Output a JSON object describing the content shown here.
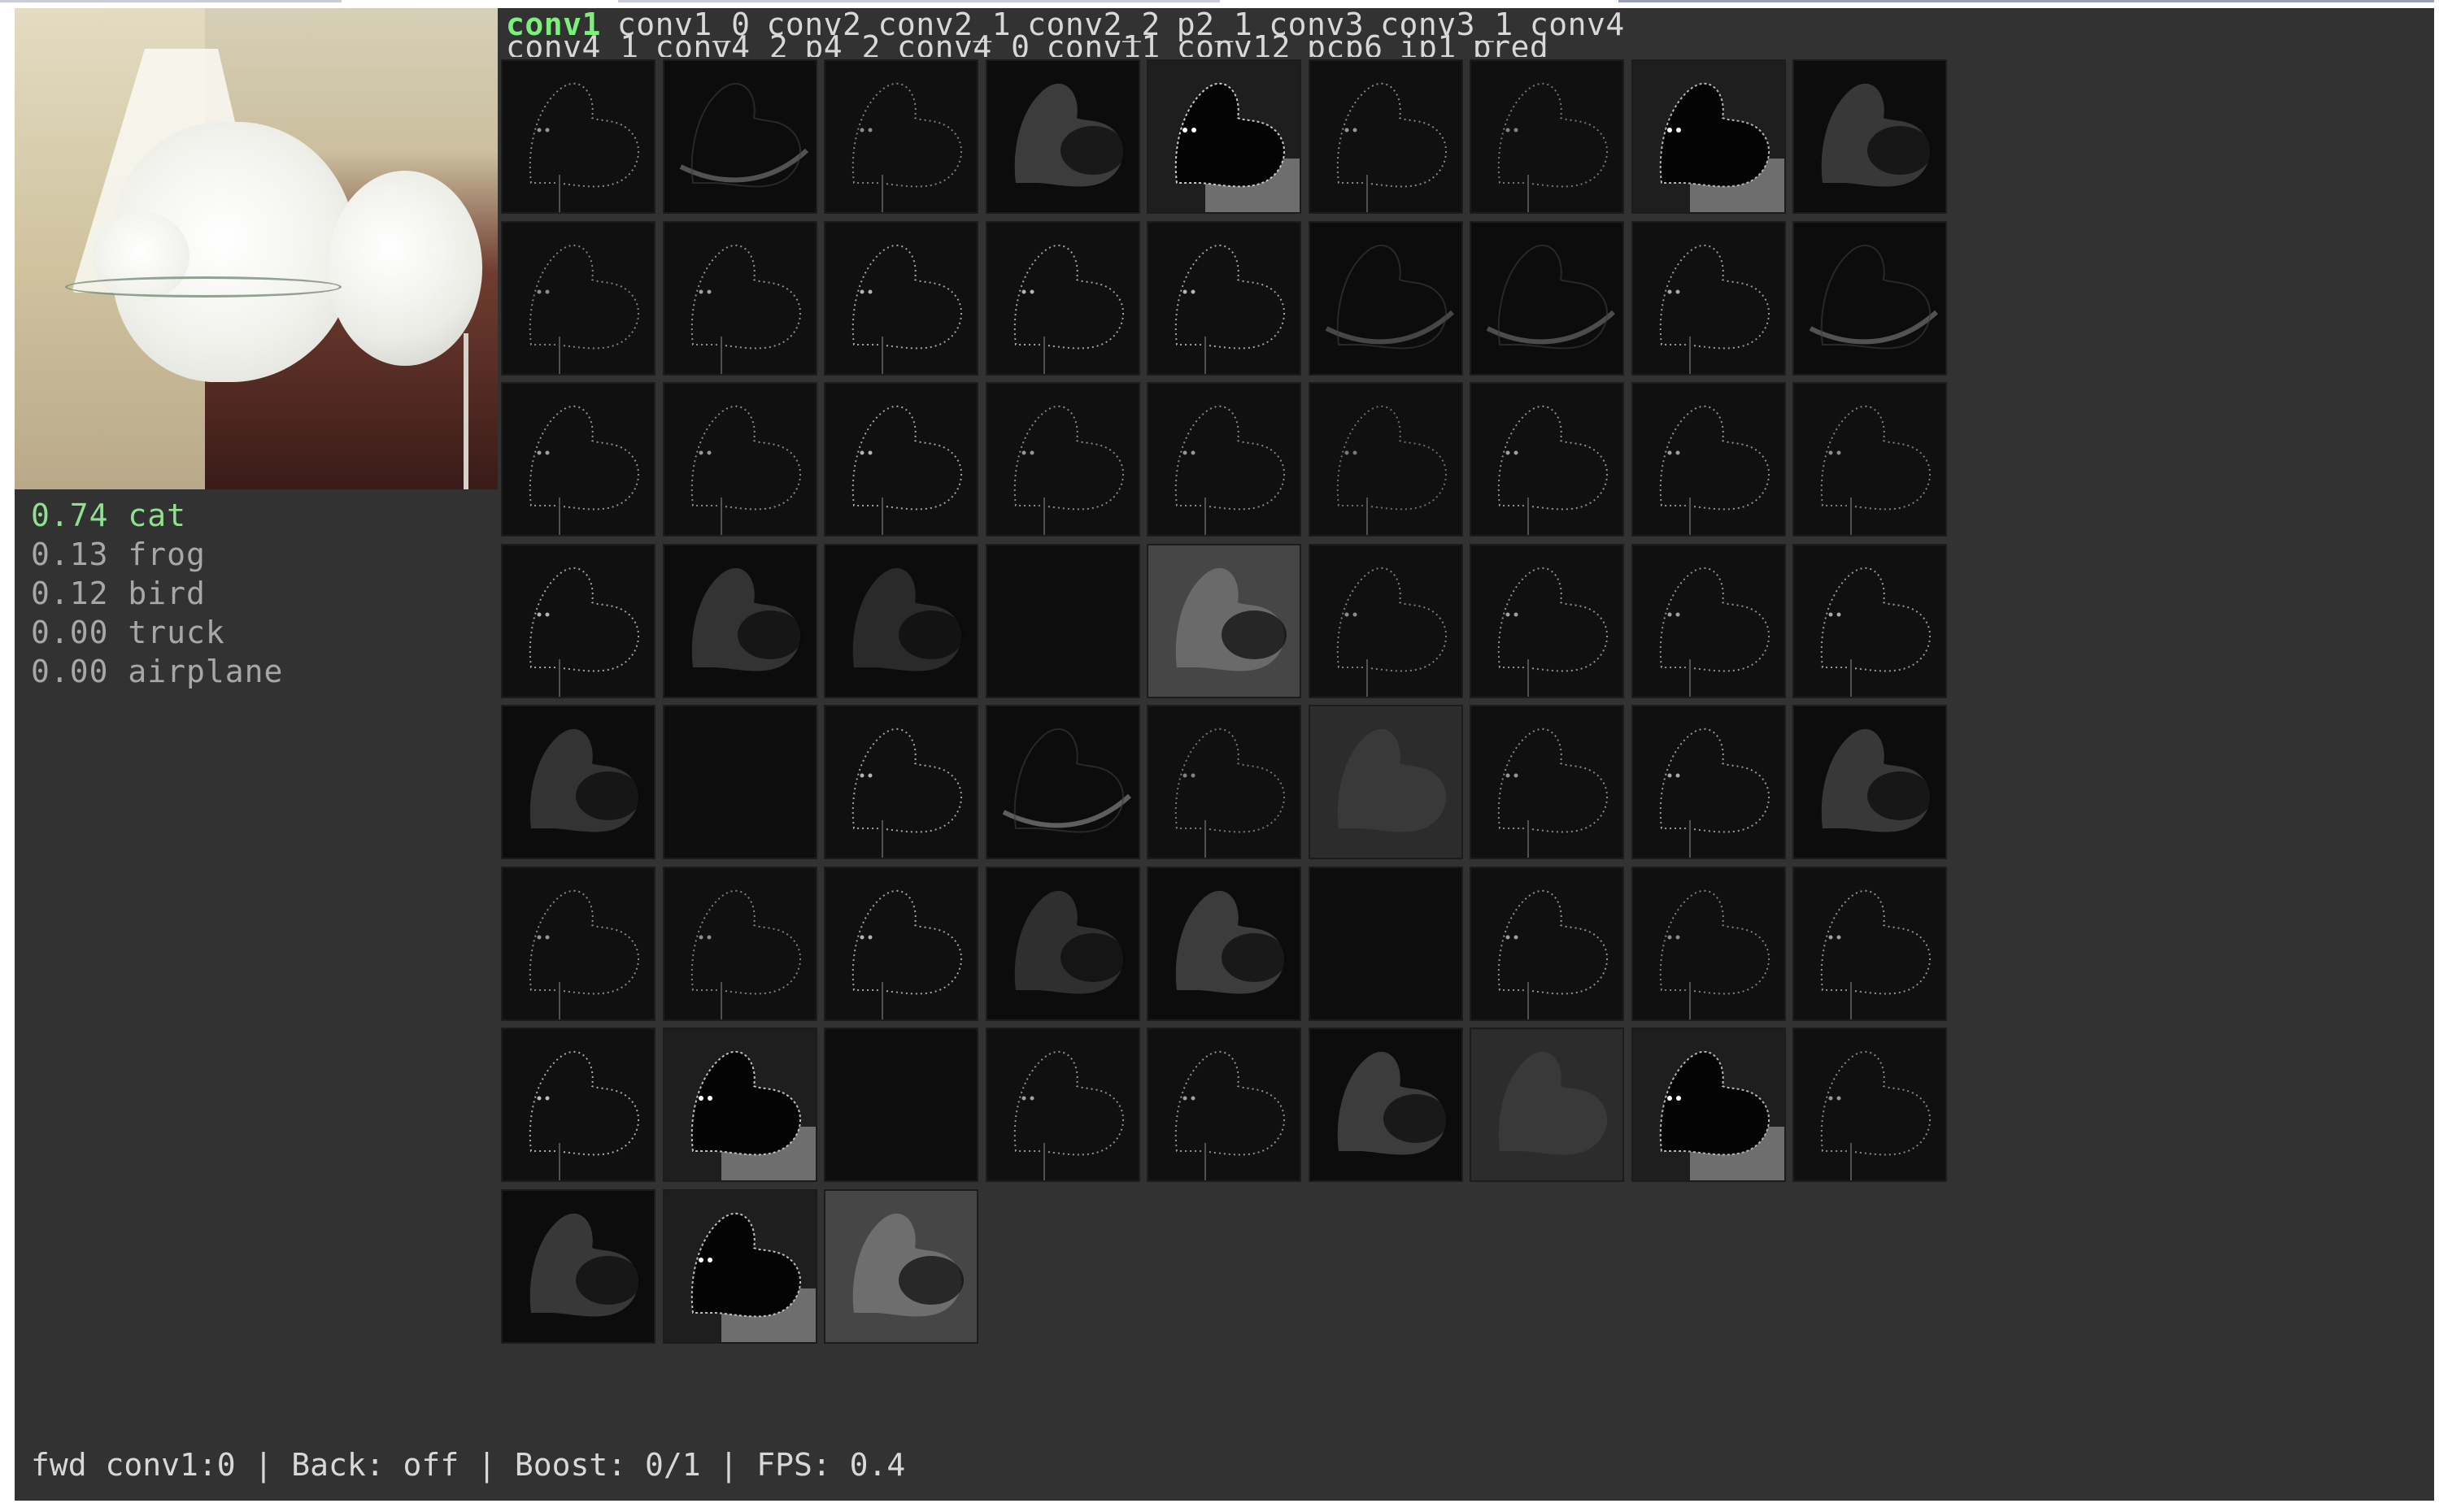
{
  "layer_tabs": {
    "row1": [
      "conv1",
      "conv1_0",
      "conv2",
      "conv2_1",
      "conv2_2",
      "p2_1",
      "conv3",
      "conv3_1",
      "conv4"
    ],
    "row2": [
      "conv4_1",
      "conv4_2",
      "p4_2",
      "conv4_0",
      "conv11",
      "conv12",
      "pcp6",
      "ip1",
      "pred"
    ],
    "active": "conv1"
  },
  "predictions": [
    {
      "score": "0.74",
      "label": "cat"
    },
    {
      "score": "0.13",
      "label": "frog"
    },
    {
      "score": "0.12",
      "label": "bird"
    },
    {
      "score": "0.00",
      "label": "truck"
    },
    {
      "score": "0.00",
      "label": "airplane"
    }
  ],
  "status": {
    "text": "fwd conv1:0 | Back: off | Boost: 0/1 | FPS: 0.4"
  },
  "activation_tiles": [
    {
      "glyph": "outline-dots",
      "level": 0.55
    },
    {
      "glyph": "dim-curve",
      "level": 0.45
    },
    {
      "glyph": "outline-dots",
      "level": 0.5
    },
    {
      "glyph": "smudge",
      "level": 0.4
    },
    {
      "glyph": "filled-bright",
      "level": 0.8
    },
    {
      "glyph": "outline-dots",
      "level": 0.55
    },
    {
      "glyph": "outline-dots",
      "level": 0.45
    },
    {
      "glyph": "filled-bright",
      "level": 0.7
    },
    {
      "glyph": "smudge",
      "level": 0.35
    },
    {
      "glyph": "outline-dots",
      "level": 0.5
    },
    {
      "glyph": "outline-dots",
      "level": 0.6
    },
    {
      "glyph": "outline-dots",
      "level": 0.7
    },
    {
      "glyph": "outline-dots",
      "level": 0.7
    },
    {
      "glyph": "outline-dots",
      "level": 0.7
    },
    {
      "glyph": "dim-curve",
      "level": 0.35
    },
    {
      "glyph": "dim-curve",
      "level": 0.4
    },
    {
      "glyph": "outline-dots",
      "level": 0.65
    },
    {
      "glyph": "dim-curve",
      "level": 0.45
    },
    {
      "glyph": "outline-dots",
      "level": 0.6
    },
    {
      "glyph": "outline-dots",
      "level": 0.55
    },
    {
      "glyph": "outline-dots",
      "level": 0.7
    },
    {
      "glyph": "outline-dots",
      "level": 0.55
    },
    {
      "glyph": "outline-dots",
      "level": 0.55
    },
    {
      "glyph": "outline-dots",
      "level": 0.4
    },
    {
      "glyph": "outline-dots",
      "level": 0.6
    },
    {
      "glyph": "outline-dots",
      "level": 0.6
    },
    {
      "glyph": "outline-dots",
      "level": 0.5
    },
    {
      "glyph": "outline-dots",
      "level": 0.7
    },
    {
      "glyph": "smudge",
      "level": 0.3
    },
    {
      "glyph": "smudge",
      "level": 0.2
    },
    {
      "glyph": "empty",
      "level": 0.05
    },
    {
      "glyph": "smudge-bright",
      "level": 0.55
    },
    {
      "glyph": "outline-dots",
      "level": 0.5
    },
    {
      "glyph": "outline-dots",
      "level": 0.6
    },
    {
      "glyph": "outline-dots",
      "level": 0.6
    },
    {
      "glyph": "outline-dots",
      "level": 0.65
    },
    {
      "glyph": "smudge",
      "level": 0.3
    },
    {
      "glyph": "empty",
      "level": 0.05
    },
    {
      "glyph": "outline-dots",
      "level": 0.7
    },
    {
      "glyph": "dim-curve",
      "level": 0.55
    },
    {
      "glyph": "outline-dots",
      "level": 0.45
    },
    {
      "glyph": "haze",
      "level": 0.25
    },
    {
      "glyph": "outline-dots",
      "level": 0.55
    },
    {
      "glyph": "outline-dots",
      "level": 0.65
    },
    {
      "glyph": "smudge",
      "level": 0.35
    },
    {
      "glyph": "outline-dots",
      "level": 0.55
    },
    {
      "glyph": "outline-dots",
      "level": 0.5
    },
    {
      "glyph": "outline-dots",
      "level": 0.7
    },
    {
      "glyph": "smudge",
      "level": 0.25
    },
    {
      "glyph": "smudge",
      "level": 0.4
    },
    {
      "glyph": "empty",
      "level": 0.05
    },
    {
      "glyph": "outline-dots",
      "level": 0.6
    },
    {
      "glyph": "outline-dots",
      "level": 0.5
    },
    {
      "glyph": "outline-dots",
      "level": 0.6
    },
    {
      "glyph": "outline-dots",
      "level": 0.75
    },
    {
      "glyph": "filled-bright",
      "level": 0.75
    },
    {
      "glyph": "empty",
      "level": 0.08
    },
    {
      "glyph": "outline-dots",
      "level": 0.6
    },
    {
      "glyph": "outline-dots",
      "level": 0.6
    },
    {
      "glyph": "smudge",
      "level": 0.4
    },
    {
      "glyph": "haze",
      "level": 0.2
    },
    {
      "glyph": "filled-bright",
      "level": 0.7
    },
    {
      "glyph": "outline-dots",
      "level": 0.55
    },
    {
      "glyph": "smudge",
      "level": 0.35
    },
    {
      "glyph": "filled-bright",
      "level": 0.75
    },
    {
      "glyph": "smudge-bright",
      "level": 0.6
    }
  ]
}
